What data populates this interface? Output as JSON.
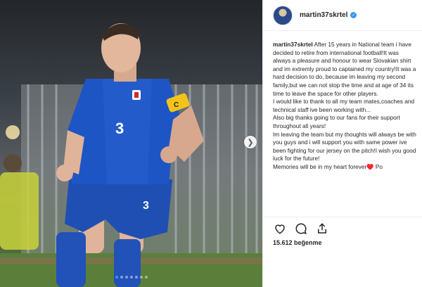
{
  "post": {
    "username": "martin37skrtel",
    "verified_icon": "verified-badge-icon",
    "caption": {
      "username": "martin37skrtel",
      "paragraphs": [
        "After 15 years in National team i have decided to retire from international football!It was always a pleasure and honour to wear Slovakian shirt and im extremly proud to captained my country!It was a hard decision to do, because im leaving my second family,but we can not stop the time and at age of 34 its time to leave the space for other players.",
        "I would like to thank to all my team mates,coaches and technical staff ive been working with...",
        "Also big thanks going to our fans for their support throughout all years!",
        "Im leaving the team but my thoughts will always be with you guys and i will support you with same power ive been fighting for our jersey on the pitch!I wish you good luck for the future!",
        "Memories will be in my heart forever♥️ Po"
      ]
    },
    "likes": "15.612 beğenme",
    "actions": {
      "like_icon": "heart-icon",
      "comment_icon": "comment-icon",
      "share_icon": "share-icon"
    },
    "media": {
      "player_number": "3",
      "captain_band": "C",
      "carousel_total": 7,
      "carousel_active": 1,
      "next_icon": "chevron-right-icon"
    }
  }
}
